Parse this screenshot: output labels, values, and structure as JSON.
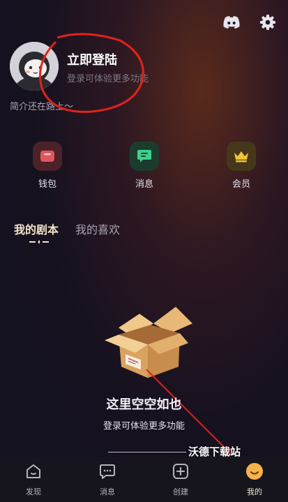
{
  "header": {
    "icons": [
      "discord-icon",
      "gear-icon"
    ]
  },
  "profile": {
    "login_title": "立即登陆",
    "login_subtitle": "登录可体验更多功能",
    "bio": "简介还在路上～"
  },
  "quick_actions": [
    {
      "label": "钱包",
      "icon": "wallet-icon",
      "color": "#e2555e"
    },
    {
      "label": "消息",
      "icon": "message-icon",
      "color": "#3fcf8a"
    },
    {
      "label": "会员",
      "icon": "crown-icon",
      "color": "#f2c53a"
    }
  ],
  "tabs": [
    {
      "label": "我的剧本",
      "active": true
    },
    {
      "label": "我的喜欢",
      "active": false
    }
  ],
  "empty_state": {
    "title": "这里空空如也",
    "subtitle": "登录可体验更多功能",
    "illustration": "empty-box-icon"
  },
  "watermark": "沃德下载站",
  "bottom_nav": [
    {
      "label": "发现",
      "icon": "home-icon",
      "active": false
    },
    {
      "label": "消息",
      "icon": "chat-icon",
      "active": false
    },
    {
      "label": "创建",
      "icon": "plus-square-icon",
      "active": false
    },
    {
      "label": "我的",
      "icon": "profile-smile-icon",
      "active": true
    }
  ],
  "colors": {
    "annotation_red": "#e0231c",
    "accent_gold": "#f5e6c8"
  }
}
